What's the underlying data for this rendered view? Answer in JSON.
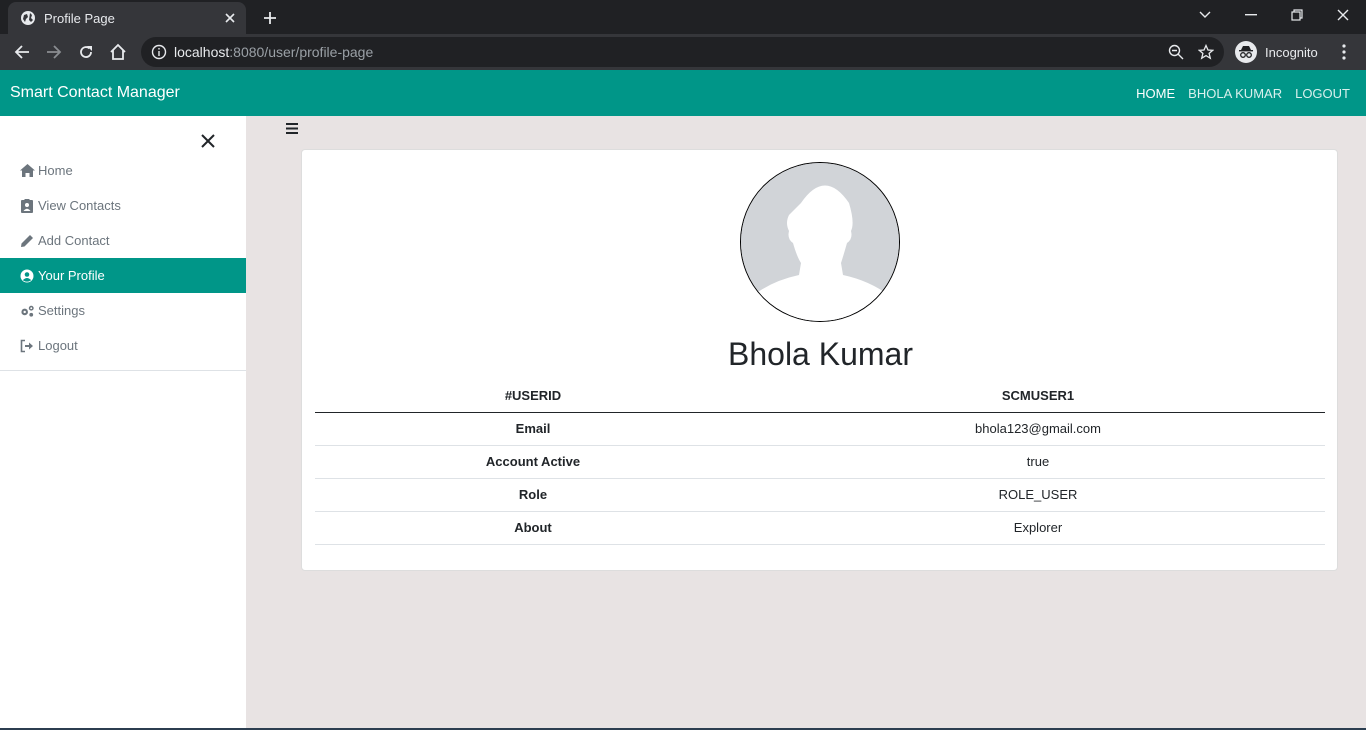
{
  "browser": {
    "tab_title": "Profile Page",
    "url_host": "localhost",
    "url_rest": ":8080/user/profile-page",
    "incognito_label": "Incognito"
  },
  "app": {
    "brand": "Smart Contact Manager",
    "nav": [
      {
        "label": "HOME",
        "active": true
      },
      {
        "label": "BHOLA KUMAR",
        "active": false
      },
      {
        "label": "LOGOUT",
        "active": false
      }
    ],
    "accent": "#009688"
  },
  "sidebar": {
    "items": [
      {
        "label": "Home",
        "icon": "home-icon"
      },
      {
        "label": "View Contacts",
        "icon": "contacts-icon"
      },
      {
        "label": "Add Contact",
        "icon": "pencil-icon"
      },
      {
        "label": "Your Profile",
        "icon": "user-circle-icon",
        "active": true
      },
      {
        "label": "Settings",
        "icon": "gears-icon"
      },
      {
        "label": "Logout",
        "icon": "sign-out-icon"
      }
    ]
  },
  "profile": {
    "name": "Bhola Kumar",
    "header": [
      "#USERID",
      "SCMUSER1"
    ],
    "rows": [
      {
        "key": "Email",
        "value": "bhola123@gmail.com"
      },
      {
        "key": "Account Active",
        "value": "true"
      },
      {
        "key": "Role",
        "value": "ROLE_USER"
      },
      {
        "key": "About",
        "value": "Explorer"
      }
    ]
  }
}
